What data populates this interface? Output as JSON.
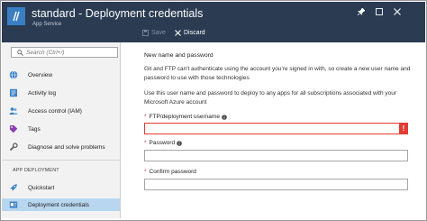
{
  "header": {
    "title": "standard - Deployment credentials",
    "subtitle": "App Service",
    "save_label": "Save",
    "discard_label": "Discard"
  },
  "sidebar": {
    "search_placeholder": "Search (Ctrl+/)",
    "items": [
      {
        "label": "Overview",
        "icon": "globe-icon"
      },
      {
        "label": "Activity log",
        "icon": "activity-log-icon"
      },
      {
        "label": "Access control (IAM)",
        "icon": "people-icon"
      },
      {
        "label": "Tags",
        "icon": "tag-icon"
      },
      {
        "label": "Diagnose and solve problems",
        "icon": "wrench-icon"
      }
    ],
    "section_label": "APP DEPLOYMENT",
    "deploy_items": [
      {
        "label": "Quickstart",
        "icon": "rocket-icon"
      },
      {
        "label": "Deployment credentials",
        "icon": "credentials-icon",
        "selected": true
      }
    ]
  },
  "main": {
    "heading": "New name and password",
    "para1": "Git and FTP can't authenticate using the account you're signed in with, so create a new user name and password to use with those technologies",
    "para2": "Use this user name and password to deploy to any apps for all subscriptions associated with your Microsoft Azure account",
    "username_label": "FTP/deployment username",
    "username_value": "",
    "password_label": "Password",
    "password_value": "",
    "confirm_label": "Confirm password",
    "confirm_value": "",
    "required_mark": "*",
    "error_mark": "!"
  },
  "colors": {
    "header_bg": "#2a3b52",
    "accent": "#3a7fc4",
    "selected_bg": "#b8d6ef",
    "error": "#e03c31"
  }
}
